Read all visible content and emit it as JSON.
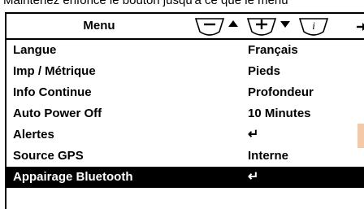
{
  "caption": "Maintenez enfoncé le bouton jusqu'à ce que le menu",
  "menu": {
    "title": "Menu",
    "rows": [
      {
        "label": "Langue",
        "value": "Français"
      },
      {
        "label": "Imp / Métrique",
        "value": "Pieds"
      },
      {
        "label": "Info Continue",
        "value": "Profondeur"
      },
      {
        "label": "Auto Power Off",
        "value": "10 Minutes"
      },
      {
        "label": "Alertes",
        "value": "↵"
      },
      {
        "label": "Source GPS",
        "value": "Interne"
      },
      {
        "label": "Appairage Bluetooth",
        "value": "↵"
      }
    ]
  },
  "icons": {
    "minus_up": "minus-up-arrow-icon",
    "plus_down": "plus-down-arrow-icon",
    "info": "info-icon",
    "exit": "exit-icon"
  },
  "colors": {
    "highlight_bg": "#000000",
    "highlight_fg": "#ffffff",
    "side_tab": "#f4c9a8"
  }
}
